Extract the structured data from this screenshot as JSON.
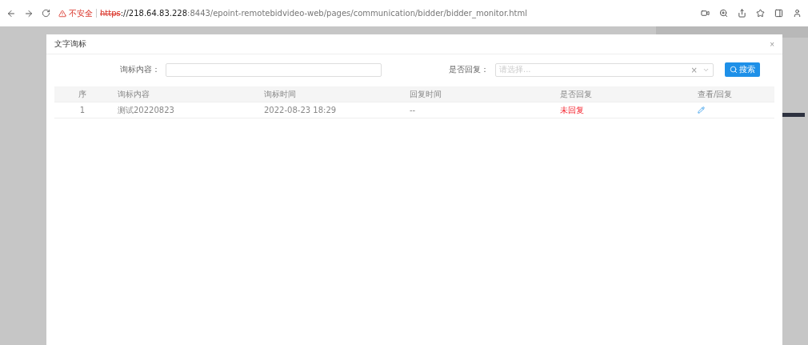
{
  "browser": {
    "security": "不安全",
    "url_scheme": "https",
    "url_host": "://218.64.83.228",
    "url_path": ":8443/epoint-remotebidvideo-web/pages/communication/bidder/bidder_monitor.html"
  },
  "dialog": {
    "title": "文字询标",
    "close": "×"
  },
  "filters": {
    "content_label": "询标内容：",
    "reply_label": "是否回复：",
    "reply_placeholder": "请选择...",
    "clear": "×",
    "search_button": "搜索"
  },
  "table": {
    "columns": [
      "序",
      "询标内容",
      "询标时间",
      "回复时间",
      "是否回复",
      "查看/回复"
    ],
    "rows": [
      {
        "index": "1",
        "content": "测试20220823",
        "time": "2022-08-23 18:29",
        "reply_time": "--",
        "status": "未回复",
        "replied": false
      }
    ]
  }
}
